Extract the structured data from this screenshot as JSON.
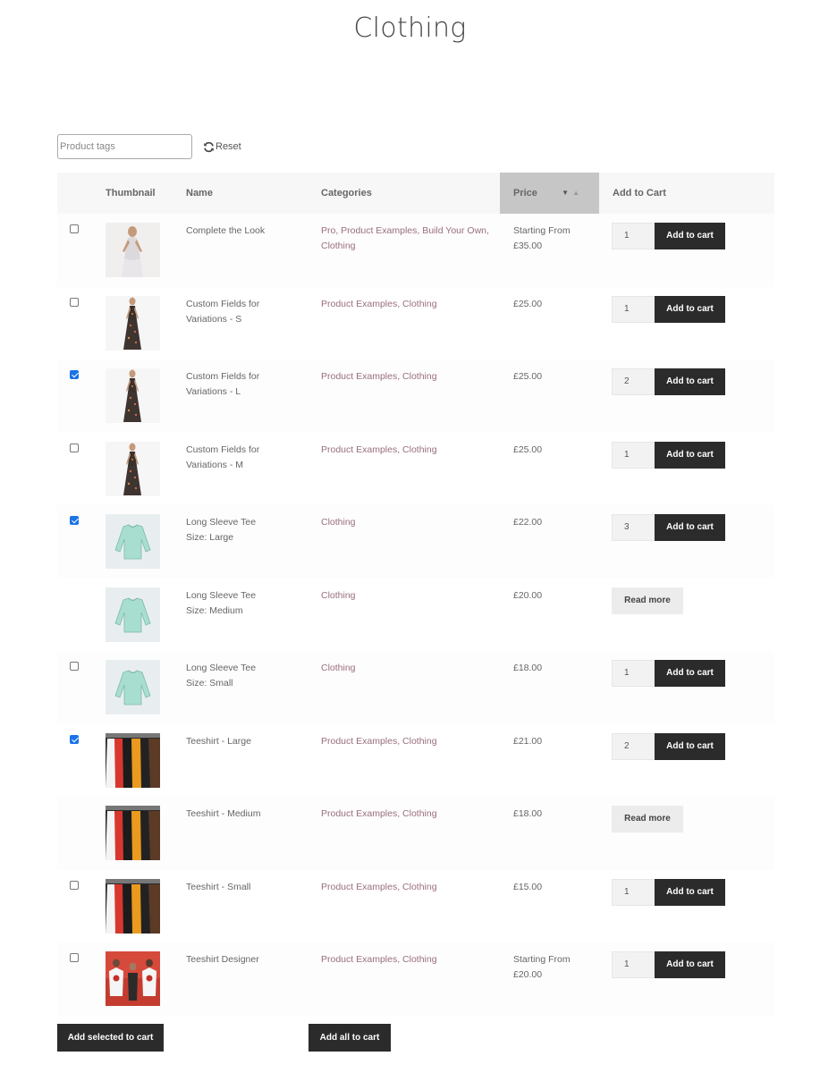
{
  "page": {
    "title": "Clothing"
  },
  "filters": {
    "tags_placeholder": "Product tags",
    "reset_label": "Reset"
  },
  "table": {
    "columns": {
      "thumbnail": "Thumbnail",
      "name": "Name",
      "categories": "Categories",
      "price": "Price",
      "add_to_cart": "Add to Cart"
    },
    "sort": {
      "column": "Price",
      "direction": "descending"
    },
    "rows": [
      {
        "checked": false,
        "thumb": "woman-dress",
        "name_line1": "Complete the Look",
        "name_line2": "",
        "categories": "Pro, Product Examples, Build Your Own, Clothing",
        "price_line1": "Starting From",
        "price_line2": "£35.00",
        "qty": "1",
        "action": "Add to cart"
      },
      {
        "checked": false,
        "thumb": "floral-dress",
        "name_line1": "Custom Fields for",
        "name_line2": "Variations - S",
        "categories": "Product Examples, Clothing",
        "price_line1": "£25.00",
        "price_line2": "",
        "qty": "1",
        "action": "Add to cart"
      },
      {
        "checked": true,
        "thumb": "floral-dress",
        "name_line1": "Custom Fields for",
        "name_line2": "Variations - L",
        "categories": "Product Examples, Clothing",
        "price_line1": "£25.00",
        "price_line2": "",
        "qty": "2",
        "action": "Add to cart"
      },
      {
        "checked": false,
        "thumb": "floral-dress",
        "name_line1": "Custom Fields for",
        "name_line2": "Variations - M",
        "categories": "Product Examples, Clothing",
        "price_line1": "£25.00",
        "price_line2": "",
        "qty": "1",
        "action": "Add to cart"
      },
      {
        "checked": true,
        "thumb": "mint-sweater",
        "name_line1": "Long Sleeve Tee",
        "name_line2": "Size: Large",
        "categories": "Clothing",
        "price_line1": "£22.00",
        "price_line2": "",
        "qty": "3",
        "action": "Add to cart"
      },
      {
        "checked": null,
        "thumb": "mint-sweater",
        "name_line1": "Long Sleeve Tee",
        "name_line2": "Size: Medium",
        "categories": "Clothing",
        "price_line1": "£20.00",
        "price_line2": "",
        "qty": null,
        "action": "Read more"
      },
      {
        "checked": false,
        "thumb": "mint-sweater",
        "name_line1": "Long Sleeve Tee",
        "name_line2": "Size: Small",
        "categories": "Clothing",
        "price_line1": "£18.00",
        "price_line2": "",
        "qty": "1",
        "action": "Add to cart"
      },
      {
        "checked": true,
        "thumb": "tshirt-rack",
        "name_line1": "Teeshirt - Large",
        "name_line2": "",
        "categories": "Product Examples, Clothing",
        "price_line1": "£21.00",
        "price_line2": "",
        "qty": "2",
        "action": "Add to cart"
      },
      {
        "checked": null,
        "thumb": "tshirt-rack",
        "name_line1": "Teeshirt - Medium",
        "name_line2": "",
        "categories": "Product Examples, Clothing",
        "price_line1": "£18.00",
        "price_line2": "",
        "qty": null,
        "action": "Read more"
      },
      {
        "checked": false,
        "thumb": "tshirt-rack",
        "name_line1": "Teeshirt - Small",
        "name_line2": "",
        "categories": "Product Examples, Clothing",
        "price_line1": "£15.00",
        "price_line2": "",
        "qty": "1",
        "action": "Add to cart"
      },
      {
        "checked": false,
        "thumb": "tshirt-designer",
        "name_line1": "Teeshirt Designer",
        "name_line2": "",
        "categories": "Product Examples, Clothing",
        "price_line1": "Starting From",
        "price_line2": "£20.00",
        "qty": "1",
        "action": "Add to cart"
      }
    ]
  },
  "footer": {
    "add_selected_label": "Add selected to cart",
    "add_all_label": "Add all to cart"
  },
  "colors": {
    "button_dark": "#2b2b2b",
    "category_link": "#9a6e7f",
    "sorted_header": "#c6c6c6",
    "checkbox_checked": "#1a73e8"
  }
}
